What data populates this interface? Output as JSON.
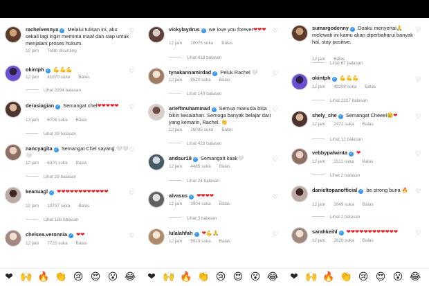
{
  "columns": [
    {
      "comments": [
        {
          "user": "rachelvennya",
          "text": "Melalui tulisan ini, aku sekali lagi ingin meminta maaf dan siap untuk menjalani proses hukum.",
          "time": "12 jam",
          "likes": "",
          "reply": "",
          "extra": "Telah disunting",
          "replies": ""
        },
        {
          "user": "okintph",
          "text": "💪💪💪",
          "time": "12 jam",
          "likes": "41870 suka",
          "reply": "Balas",
          "replies": "Lihat 2294 balasan"
        },
        {
          "user": "derasiagian",
          "text": "Semangat chel❤❤❤❤❤",
          "time": "13 jam",
          "likes": "6706 suka",
          "reply": "Balas",
          "replies": "Lihat 39 balasan"
        },
        {
          "user": "nancyagita",
          "text": "Semangat Chel sayang 🤍🤍🤍",
          "time": "12 jam",
          "likes": "6370 suka",
          "reply": "Balas",
          "replies": "Lihat 29 balasan"
        },
        {
          "user": "keanuagl",
          "text": "❤❤❤❤❤❤❤❤❤❤❤❤",
          "time": "12 jam",
          "likes": "10797 suka",
          "reply": "Balas",
          "replies": "Lihat 186 balasan"
        },
        {
          "user": "chelsea.veronnia",
          "text": "❤❤",
          "time": "12 jam",
          "likes": "7725 suka",
          "reply": "Balas",
          "replies": ""
        }
      ]
    },
    {
      "comments": [
        {
          "user": "vickylaydrus",
          "text": "we love you forever❤❤❤",
          "time": "12 jam",
          "likes": "10075 suka",
          "reply": "Balas",
          "replies": "Lihat 419 balasan"
        },
        {
          "user": "tynakannamirdad",
          "text": "Peluk Rachel 🤍",
          "time": "12 jam",
          "likes": "6520 suka",
          "reply": "Balas",
          "replies": "Lihat 140 balasan"
        },
        {
          "user": "arieffmuhammad",
          "text": "Semua manusia bisa bikin kesalahan. Semoga banyak belajar dari yang kemarin, Rachel. 👏",
          "time": "12 jam",
          "likes": "26095 suka",
          "reply": "Balas",
          "replies": "Lihat 423 balasan"
        },
        {
          "user": "andsur18",
          "text": "Semangatt kaak🤍",
          "time": "12 jam",
          "likes": "4485 suka",
          "reply": "Balas",
          "replies": "Lihat 24 balasan"
        },
        {
          "user": "alvasus",
          "text": "❤❤❤❤",
          "time": "12 jam",
          "likes": "3904 suka",
          "reply": "Balas",
          "replies": "Lihat 3 balasan"
        },
        {
          "user": "lulalahfah",
          "text": "❤💪🙏",
          "time": "12 jam",
          "likes": "5919 suka",
          "reply": "Balas",
          "replies": ""
        }
      ]
    },
    {
      "comments": [
        {
          "user": "sumargodenny",
          "text": "Doaku menyertai🙏 melewati ini kamu akan diperbaharui banyak hal, stay positive.",
          "time": "12 jam",
          "likes": "",
          "reply": "Balas",
          "replies": "Lihat 67 balasan"
        },
        {
          "user": "okintph",
          "text": "💪💪💪",
          "time": "12 jam",
          "likes": "42208 suka",
          "reply": "Balas",
          "replies": "Lihat 2317 balasan"
        },
        {
          "user": "shely_che",
          "text": "Semangat Cheeel😢❤",
          "time": "12 jam",
          "likes": "2472 suka",
          "reply": "Balas",
          "replies": "Lihat 12 balasan"
        },
        {
          "user": "vebbypalwinta",
          "text": "❤",
          "time": "12 jam",
          "likes": "2511 suka",
          "reply": "Balas",
          "replies": "Lihat 2 balasan"
        },
        {
          "user": "danieltopanofficial",
          "text": "be strong buna 🔥",
          "time": "12 jam",
          "likes": "2049 suka",
          "reply": "Balas",
          "replies": "Lihat 2 balasan"
        },
        {
          "user": "sarahkeihl",
          "text": "❤❤❤❤❤❤❤❤❤❤❤❤",
          "time": "12 jam",
          "likes": "2620 suka",
          "reply": "Balas",
          "replies": ""
        }
      ]
    }
  ],
  "reactions": [
    "❤",
    "🙌",
    "🔥",
    "👏",
    "😢",
    "😍",
    "😮",
    "😂"
  ],
  "colors": {
    "accent": "#3897f0",
    "heart": "#ed1c24",
    "muted": "#8e8e8e"
  }
}
